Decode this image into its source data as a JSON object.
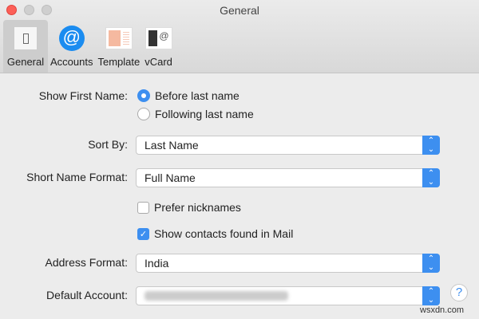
{
  "window": {
    "title": "General"
  },
  "tabs": [
    {
      "label": "General"
    },
    {
      "label": "Accounts"
    },
    {
      "label": "Template"
    },
    {
      "label": "vCard"
    }
  ],
  "form": {
    "show_first_name_label": "Show First Name:",
    "radio_before": "Before last name",
    "radio_following": "Following last name",
    "sort_by_label": "Sort By:",
    "sort_by_value": "Last Name",
    "short_name_label": "Short Name Format:",
    "short_name_value": "Full Name",
    "prefer_nicknames": "Prefer nicknames",
    "show_contacts": "Show contacts found in Mail",
    "address_label": "Address Format:",
    "address_value": "India",
    "default_account_label": "Default Account:"
  },
  "help": "?",
  "watermark": "wsxdn.com"
}
